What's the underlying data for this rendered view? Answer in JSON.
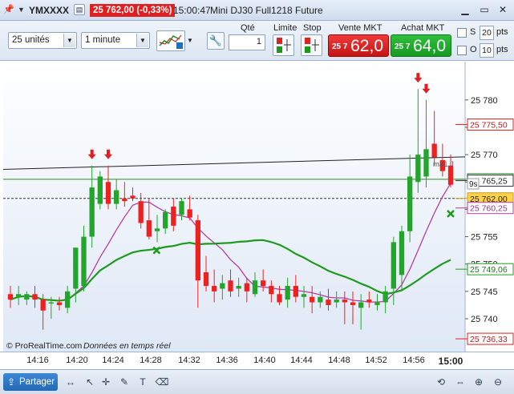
{
  "titlebar": {
    "dropdown": "▼",
    "symbol": "YMXXXX",
    "price_badge": "25 762,00 (-0,33%)",
    "time": "15:00:47",
    "instrument": "Mini DJ30 Full1218 Future"
  },
  "toolbar": {
    "units_select": "25 unités",
    "interval_select": "1 minute",
    "qty_label": "Qté",
    "qty_value": "1",
    "limit_label": "Limite",
    "stop_label": "Stop",
    "sell_label": "Vente MKT",
    "sell_prefix": "25 7",
    "sell_price": "62,0",
    "buy_label": "Achat MKT",
    "buy_prefix": "25 7",
    "buy_price": "64,0",
    "s_label": "S",
    "s_value": "20",
    "o_label": "O",
    "o_value": "10",
    "pts": "pts"
  },
  "chart": {
    "watermark": "© ProRealTime.com",
    "watermark_note": "Données en temps réel",
    "countdown": "9s",
    "ma_label": "ma1 J",
    "colors": {
      "up": "#22a52a",
      "down": "#ee2121",
      "ma_purple": "#b33fa6",
      "ma_green": "#1e9a1e",
      "trend": "#222222",
      "hline": "#2b8a2b"
    }
  },
  "chart_data": {
    "type": "candlestick",
    "ylim": [
      25734,
      25787
    ],
    "y_ticks": [
      25780,
      25775,
      25770,
      25765,
      25760,
      25755,
      25750,
      25745,
      25740
    ],
    "x_ticks": [
      "14:16",
      "14:20",
      "14:24",
      "14:28",
      "14:32",
      "14:36",
      "14:40",
      "14:44",
      "14:48",
      "14:52",
      "14:56",
      "15:00"
    ],
    "price_labels": [
      {
        "text": "25 775,50",
        "value": 25775.5,
        "style": "red"
      },
      {
        "text": "25 765,50",
        "value": 25765.5,
        "style": "green"
      },
      {
        "text": "25 765,25",
        "value": 25765.25,
        "style": "black"
      },
      {
        "text": "25 762,00",
        "value": 25762.0,
        "style": "current"
      },
      {
        "text": "25 760,25",
        "value": 25760.25,
        "style": "purple"
      },
      {
        "text": "25 749,06",
        "value": 25749.06,
        "style": "greenline"
      },
      {
        "text": "25 736,33",
        "value": 25736.33,
        "style": "red"
      }
    ],
    "candles": [
      [
        25744.5,
        25746,
        25742,
        25743.5
      ],
      [
        25744,
        25746,
        25742.5,
        25744.5
      ],
      [
        25743.5,
        25745,
        25742.5,
        25744.5
      ],
      [
        25744.5,
        25746,
        25742,
        25743.5
      ],
      [
        25743.5,
        25744.5,
        25738,
        25741.5
      ],
      [
        25743,
        25744,
        25740,
        25743
      ],
      [
        25743,
        25744,
        25741.5,
        25742.5
      ],
      [
        25742,
        25746,
        25741,
        25745
      ],
      [
        25745.5,
        25751,
        25743,
        25753
      ],
      [
        25746,
        25757,
        25745,
        25755
      ],
      [
        25755,
        25768,
        25753,
        25764
      ],
      [
        25761,
        25767,
        25760,
        25766
      ],
      [
        25765,
        25768,
        25760,
        25761
      ],
      [
        25761,
        25765.5,
        25760,
        25763.5
      ],
      [
        25762,
        25765,
        25760.5,
        25761.5
      ],
      [
        25762.5,
        25764,
        25761.5,
        25762
      ],
      [
        25761.5,
        25763,
        25756.5,
        25757.5
      ],
      [
        25758,
        25762,
        25754.5,
        25755
      ],
      [
        25756,
        25759,
        25754,
        25756.5
      ],
      [
        25756.5,
        25760,
        25755.5,
        25759.5
      ],
      [
        25760.5,
        25762,
        25756,
        25757
      ],
      [
        25759,
        25762,
        25758,
        25761.5
      ],
      [
        25760,
        25762.5,
        25758,
        25758.5
      ],
      [
        25758,
        25759,
        25742,
        25747
      ],
      [
        25748.5,
        25751.5,
        25745,
        25746
      ],
      [
        25746,
        25749,
        25743,
        25745
      ],
      [
        25745.5,
        25748,
        25743.5,
        25746.5
      ],
      [
        25747,
        25749,
        25744,
        25745
      ],
      [
        25745.5,
        25747.5,
        25744,
        25746
      ],
      [
        25746.5,
        25747.5,
        25743,
        25745
      ],
      [
        25744.5,
        25748.5,
        25744,
        25747
      ],
      [
        25747,
        25749,
        25745,
        25746
      ],
      [
        25746,
        25747,
        25743,
        25744.5
      ],
      [
        25744.5,
        25746,
        25742.5,
        25743
      ],
      [
        25743.5,
        25747.5,
        25742,
        25746
      ],
      [
        25746,
        25748,
        25743,
        25744
      ],
      [
        25744,
        25746,
        25742,
        25744.5
      ],
      [
        25744,
        25746,
        25741,
        25743
      ],
      [
        25743,
        25745,
        25742,
        25744
      ],
      [
        25743.5,
        25745.5,
        25741.5,
        25742.5
      ],
      [
        25743,
        25745,
        25742,
        25743.5
      ],
      [
        25743.5,
        25745,
        25739,
        25743
      ],
      [
        25743,
        25745,
        25739,
        25742.5
      ],
      [
        25742,
        25744.5,
        25738,
        25743
      ],
      [
        25743.5,
        25745,
        25742,
        25743
      ],
      [
        25742.5,
        25744.5,
        25741.5,
        25743
      ],
      [
        25743,
        25746,
        25741,
        25745
      ],
      [
        25745.5,
        25755,
        25742.5,
        25754
      ],
      [
        25748,
        25757,
        25745,
        25756
      ],
      [
        25756,
        25770,
        25754,
        25766
      ],
      [
        25765,
        25782,
        25763,
        25770
      ],
      [
        25766,
        25780,
        25764,
        25771
      ],
      [
        25772,
        25778,
        25768,
        25769.5
      ],
      [
        25769,
        25772,
        25766,
        25767
      ],
      [
        25768,
        25770,
        25764,
        25764.5
      ]
    ],
    "sell_arrows": [
      10,
      12,
      50,
      51
    ],
    "annotations": "red down arrows mark sell signals; green crosses mark exits"
  }
}
